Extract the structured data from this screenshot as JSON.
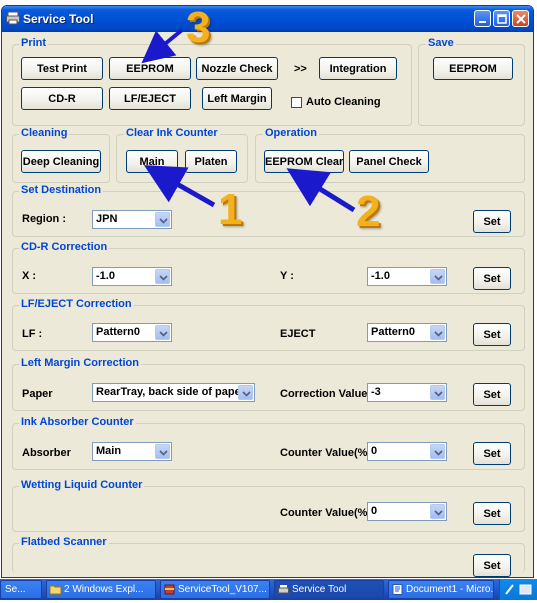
{
  "window": {
    "title": "Service Tool"
  },
  "print": {
    "label": "Print",
    "test_print": "Test Print",
    "eeprom": "EEPROM",
    "nozzle_check": "Nozzle Check",
    "arrow_text": ">>",
    "integration": "Integration",
    "cd_r": "CD-R",
    "lf_eject": "LF/EJECT",
    "left_margin": "Left Margin",
    "auto_cleaning": "Auto Cleaning"
  },
  "save": {
    "label": "Save",
    "eeprom": "EEPROM"
  },
  "cleaning": {
    "label": "Cleaning",
    "deep_cleaning": "Deep Cleaning"
  },
  "clear_ink": {
    "label": "Clear Ink Counter",
    "main": "Main",
    "platen": "Platen"
  },
  "operation": {
    "label": "Operation",
    "eeprom_clear": "EEPROM Clear",
    "panel_check": "Panel Check"
  },
  "set_destination": {
    "label": "Set Destination",
    "region_label": "Region :",
    "region_value": "JPN",
    "set": "Set"
  },
  "cdr_correction": {
    "label": "CD-R Correction",
    "x_label": "X :",
    "x_value": "-1.0",
    "y_label": "Y :",
    "y_value": "-1.0",
    "set": "Set"
  },
  "lf_eject_correction": {
    "label": "LF/EJECT Correction",
    "lf_label": "LF :",
    "lf_value": "Pattern0",
    "eject_label": "EJECT",
    "eject_value": "Pattern0",
    "set": "Set"
  },
  "left_margin_correction": {
    "label": "Left Margin Correction",
    "paper_label": "Paper",
    "paper_value": "RearTray, back side of paper",
    "cv_label": "Correction Value",
    "cv_value": "-3",
    "set": "Set"
  },
  "ink_absorber": {
    "label": "Ink Absorber Counter",
    "absorber_label": "Absorber",
    "absorber_value": "Main",
    "counter_label": "Counter Value(%)",
    "counter_value": "0",
    "set": "Set"
  },
  "wetting_liquid": {
    "label": "Wetting Liquid Counter",
    "counter_label": "Counter Value(%)",
    "counter_value": "0",
    "set": "Set"
  },
  "flatbed": {
    "label": "Flatbed Scanner",
    "set": "Set"
  },
  "annotations": {
    "one": "1",
    "two": "2",
    "three": "3",
    "arrow_color": "#1a1acc",
    "number_color": "#f3b11d"
  },
  "taskbar": {
    "items": [
      "Se...",
      "2 Windows Expl...",
      "ServiceTool_V107...",
      "Service Tool",
      "Document1 - Micro..."
    ]
  }
}
